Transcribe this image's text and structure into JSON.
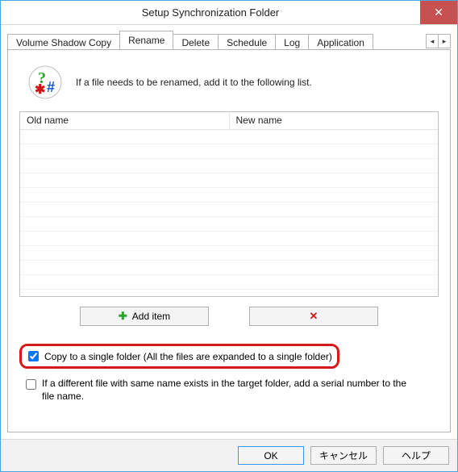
{
  "window": {
    "title": "Setup Synchronization Folder"
  },
  "tabs": {
    "t0": "Volume Shadow Copy",
    "t1": "Rename",
    "t2": "Delete",
    "t3": "Schedule",
    "t4": "Log",
    "t5": "Application",
    "active": "t1"
  },
  "intro": {
    "text": "If a file needs to be renamed, add it to the following list."
  },
  "list": {
    "col_old": "Old name",
    "col_new": "New name",
    "rows": []
  },
  "buttons": {
    "add": "Add item",
    "delete_icon": "✕"
  },
  "checks": {
    "single_folder": {
      "label": "Copy to a single folder (All the files are expanded to a single folder)",
      "checked": true
    },
    "serial": {
      "label": "If a different file with same name exists in the target folder, add a serial number to the file name.",
      "checked": false
    }
  },
  "footer": {
    "ok": "OK",
    "cancel": "キャンセル",
    "help": "ヘルプ"
  }
}
